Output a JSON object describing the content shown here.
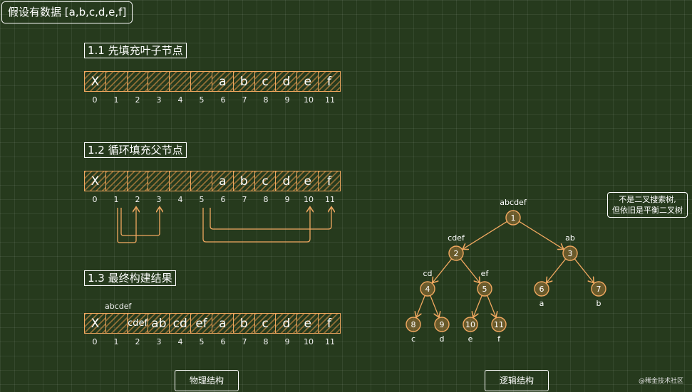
{
  "title": "假设有数据 [a,b,c,d,e,f]",
  "sections": {
    "s1": "1.1 先填充叶子节点",
    "s2": "1.2 循环填充父节点",
    "s3": "1.3 最终构建结果"
  },
  "array1": [
    "X",
    "",
    "",
    "",
    "",
    "",
    "a",
    "b",
    "c",
    "d",
    "e",
    "f"
  ],
  "array2": [
    "X",
    "",
    "",
    "",
    "",
    "",
    "a",
    "b",
    "c",
    "d",
    "e",
    "f"
  ],
  "array3": [
    "X",
    "",
    "cdef",
    "ab",
    "cd",
    "ef",
    "a",
    "b",
    "c",
    "d",
    "e",
    "f"
  ],
  "array3_above_label": "abcdef",
  "indices": [
    "0",
    "1",
    "2",
    "3",
    "4",
    "5",
    "6",
    "7",
    "8",
    "9",
    "10",
    "11"
  ],
  "tree": {
    "nodes": [
      {
        "id": "1",
        "label": "abcdef",
        "sub": ""
      },
      {
        "id": "2",
        "label": "cdef",
        "sub": ""
      },
      {
        "id": "3",
        "label": "ab",
        "sub": ""
      },
      {
        "id": "4",
        "label": "cd",
        "sub": ""
      },
      {
        "id": "5",
        "label": "ef",
        "sub": ""
      },
      {
        "id": "6",
        "label": "",
        "sub": "a"
      },
      {
        "id": "7",
        "label": "",
        "sub": "b"
      },
      {
        "id": "8",
        "label": "",
        "sub": "c"
      },
      {
        "id": "9",
        "label": "",
        "sub": "d"
      },
      {
        "id": "10",
        "label": "",
        "sub": "e"
      },
      {
        "id": "11",
        "label": "",
        "sub": "f"
      }
    ]
  },
  "note": {
    "line1": "不是二叉搜索树,",
    "line2": "但依旧是平衡二叉树"
  },
  "buttons": {
    "physical": "物理结构",
    "logical": "逻辑结构"
  },
  "watermark": "@稀金技术社区",
  "colors": {
    "accent": "#f0a860",
    "background": "#263a1d",
    "text": "#ffffff"
  }
}
